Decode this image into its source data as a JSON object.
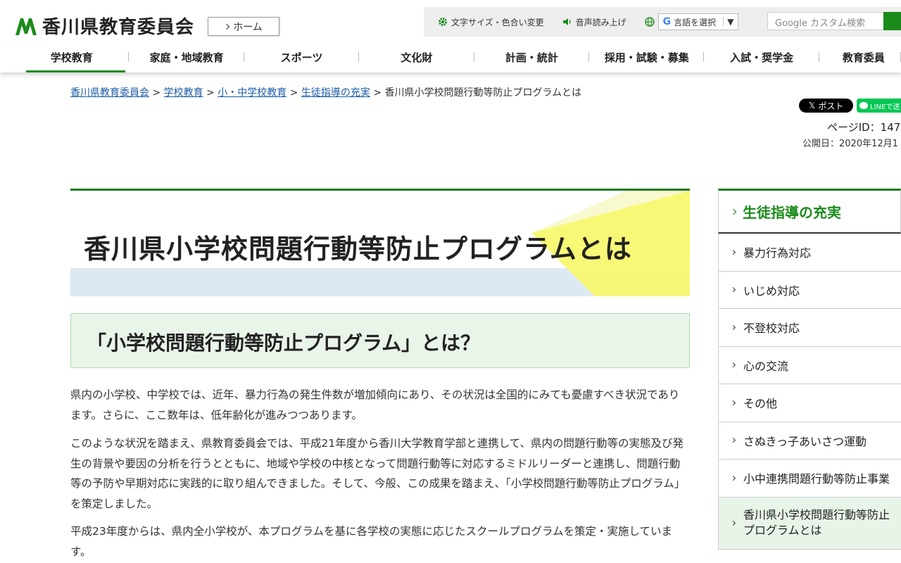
{
  "header": {
    "site_title": "香川県教育委員会",
    "home_label": "ホーム",
    "utility": {
      "text_size": "文字サイズ・色合い変更",
      "read_aloud": "音声読み上げ",
      "language_g": "G",
      "language": "言語を選択",
      "language_caret": "▼"
    },
    "search": {
      "placeholder": "Google カスタム検索"
    },
    "nav": [
      "学校教育",
      "家庭・地域教育",
      "スポーツ",
      "文化財",
      "計画・統計",
      "採用・試験・募集",
      "入試・奨学金",
      "教育委員"
    ]
  },
  "breadcrumb": {
    "items": [
      "香川県教育委員会",
      "学校教育",
      "小・中学校教育",
      "生徒指導の充実"
    ],
    "separator": " > ",
    "current": "香川県小学校問題行動等防止プログラムとは"
  },
  "social": {
    "x_label": "ポスト",
    "x_glyph": "𝕏",
    "line_label": "LINEで送る"
  },
  "meta": {
    "page_id": "ページID：147",
    "published": "公開日：2020年12月1"
  },
  "main": {
    "title": "香川県小学校問題行動等防止プログラムとは",
    "subheading": "「小学校問題行動等防止プログラム」とは？",
    "paragraphs": [
      "県内の小学校、中学校では、近年、暴力行為の発生件数が増加傾向にあり、その状況は全国的にみても憂慮すべき状況であります。さらに、ここ数年は、低年齢化が進みつつあります。",
      "このような状況を踏まえ、県教育委員会では、平成21年度から香川大学教育学部と連携して、県内の問題行動等の実態及び発生の背景や要因の分析を行うとともに、地域や学校の中核となって問題行動等に対応するミドルリーダーと連携し、問題行動等の予防や早期対応に実践的に取り組んできました。そして、今般、この成果を踏まえ、「小学校問題行動等防止プログラム」を策定しました。",
      "平成23年度からは、県内全小学校が、本プログラムを基に各学校の実態に応じたスクールプログラムを策定・実施しています。"
    ]
  },
  "sidebar": {
    "heading": "生徒指導の充実",
    "items": [
      "暴力行為対応",
      "いじめ対応",
      "不登校対応",
      "心の交流",
      "その他",
      "さぬきっ子あいさつ運動",
      "小中連携問題行動等防止事業",
      "香川県小学校問題行動等防止プログラムとは"
    ]
  },
  "colors": {
    "brand_green": "#1b8b1b",
    "link_blue": "#1a5aa8",
    "accent_yellow": "#f8f870",
    "band_blue": "#dde9f2"
  }
}
